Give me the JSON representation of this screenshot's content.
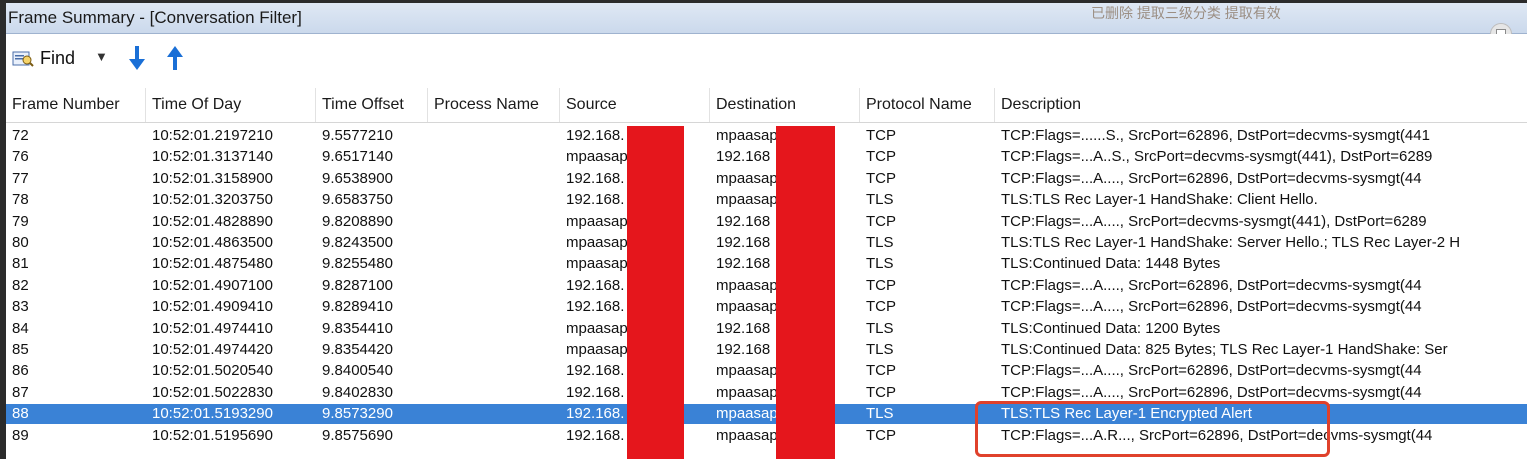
{
  "window": {
    "title": "Frame Summary - [Conversation Filter]",
    "background_text": "已删除  提取三级分类 提取有效"
  },
  "toolbar": {
    "find_label": "Find",
    "find_icon": "find-binoculars-icon",
    "down_icon": "arrow-down-icon",
    "up_icon": "arrow-up-icon",
    "accent_color": "#1a6fd6"
  },
  "columns": [
    "Frame Number",
    "Time Of Day",
    "Time Offset",
    "Process Name",
    "Source",
    "Destination",
    "Protocol Name",
    "Description"
  ],
  "rows": [
    {
      "frame": "72",
      "time": "10:52:01.2197210",
      "offset": "9.5577210",
      "process": "",
      "source": "192.168.",
      "dest": "mpaasap",
      "protocol": "TCP",
      "desc": "TCP:Flags=......S., SrcPort=62896, DstPort=decvms-sysmgt(441"
    },
    {
      "frame": "76",
      "time": "10:52:01.3137140",
      "offset": "9.6517140",
      "process": "",
      "source": "mpaasap",
      "dest": "192.168",
      "protocol": "TCP",
      "desc": "TCP:Flags=...A..S., SrcPort=decvms-sysmgt(441), DstPort=6289"
    },
    {
      "frame": "77",
      "time": "10:52:01.3158900",
      "offset": "9.6538900",
      "process": "",
      "source": "192.168.",
      "dest": "mpaasap",
      "protocol": "TCP",
      "desc": "TCP:Flags=...A...., SrcPort=62896, DstPort=decvms-sysmgt(44"
    },
    {
      "frame": "78",
      "time": "10:52:01.3203750",
      "offset": "9.6583750",
      "process": "",
      "source": "192.168.",
      "dest": "mpaasap",
      "protocol": "TLS",
      "desc": "TLS:TLS Rec Layer-1 HandShake: Client Hello."
    },
    {
      "frame": "79",
      "time": "10:52:01.4828890",
      "offset": "9.8208890",
      "process": "",
      "source": "mpaasap",
      "dest": "192.168",
      "protocol": "TCP",
      "desc": "TCP:Flags=...A...., SrcPort=decvms-sysmgt(441), DstPort=6289"
    },
    {
      "frame": "80",
      "time": "10:52:01.4863500",
      "offset": "9.8243500",
      "process": "",
      "source": "mpaasap",
      "dest": "192.168",
      "protocol": "TLS",
      "desc": "TLS:TLS Rec Layer-1 HandShake: Server Hello.; TLS Rec Layer-2 H"
    },
    {
      "frame": "81",
      "time": "10:52:01.4875480",
      "offset": "9.8255480",
      "process": "",
      "source": "mpaasap",
      "dest": "192.168",
      "protocol": "TLS",
      "desc": "TLS:Continued Data: 1448 Bytes"
    },
    {
      "frame": "82",
      "time": "10:52:01.4907100",
      "offset": "9.8287100",
      "process": "",
      "source": "192.168.",
      "dest": "mpaasap",
      "protocol": "TCP",
      "desc": "TCP:Flags=...A...., SrcPort=62896, DstPort=decvms-sysmgt(44"
    },
    {
      "frame": "83",
      "time": "10:52:01.4909410",
      "offset": "9.8289410",
      "process": "",
      "source": "192.168.",
      "dest": "mpaasap",
      "protocol": "TCP",
      "desc": "TCP:Flags=...A...., SrcPort=62896, DstPort=decvms-sysmgt(44"
    },
    {
      "frame": "84",
      "time": "10:52:01.4974410",
      "offset": "9.8354410",
      "process": "",
      "source": "mpaasap",
      "dest": "192.168",
      "protocol": "TLS",
      "desc": "TLS:Continued Data: 1200 Bytes"
    },
    {
      "frame": "85",
      "time": "10:52:01.4974420",
      "offset": "9.8354420",
      "process": "",
      "source": "mpaasap",
      "dest": "192.168",
      "protocol": "TLS",
      "desc": "TLS:Continued Data: 825 Bytes; TLS Rec Layer-1 HandShake: Ser"
    },
    {
      "frame": "86",
      "time": "10:52:01.5020540",
      "offset": "9.8400540",
      "process": "",
      "source": "192.168.",
      "dest": "mpaasap",
      "protocol": "TCP",
      "desc": "TCP:Flags=...A...., SrcPort=62896, DstPort=decvms-sysmgt(44"
    },
    {
      "frame": "87",
      "time": "10:52:01.5022830",
      "offset": "9.8402830",
      "process": "",
      "source": "192.168.",
      "dest": "mpaasap",
      "protocol": "TCP",
      "desc": "TCP:Flags=...A...., SrcPort=62896, DstPort=decvms-sysmgt(44"
    },
    {
      "frame": "88",
      "time": "10:52:01.5193290",
      "offset": "9.8573290",
      "process": "",
      "source": "192.168.",
      "dest": "mpaasap",
      "protocol": "TLS",
      "desc": "TLS:TLS Rec Layer-1 Encrypted Alert",
      "selected": true
    },
    {
      "frame": "89",
      "time": "10:52:01.5195690",
      "offset": "9.8575690",
      "process": "",
      "source": "192.168.",
      "dest": "mpaasap",
      "protocol": "TCP",
      "desc": "TCP:Flags=...A.R..., SrcPort=62896, DstPort=decvms-sysmgt(44"
    }
  ],
  "colors": {
    "selection": "#3a82d6",
    "redaction": "#e5161c",
    "callout": "#e0412b"
  }
}
